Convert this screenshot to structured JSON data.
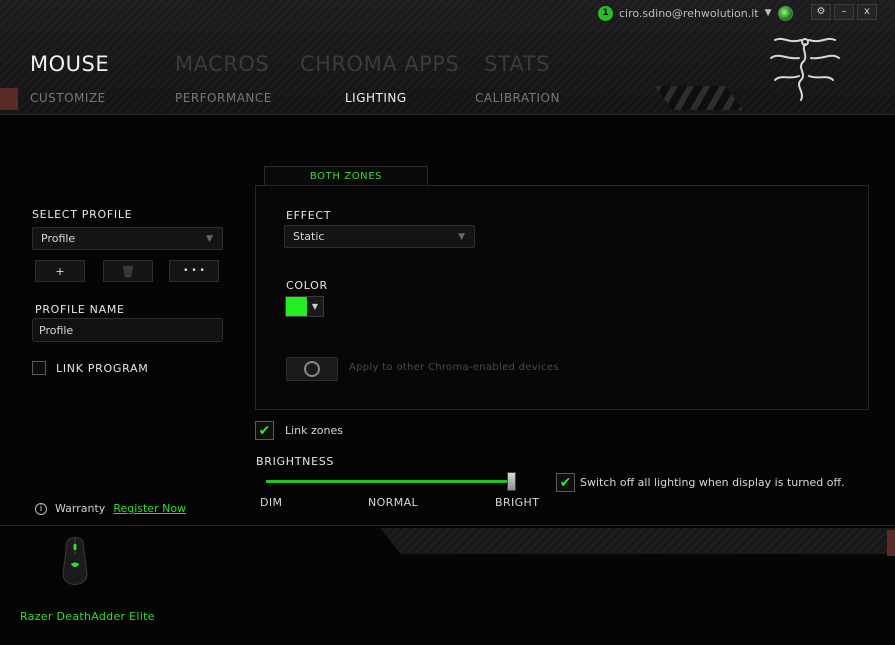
{
  "user": {
    "badge": "1",
    "email": "ciro.sdino@rehwolution.it"
  },
  "window_controls": {
    "settings": "⚙",
    "minimize": "–",
    "close": "x"
  },
  "main_nav": [
    "MOUSE",
    "MACROS",
    "CHROMA APPS",
    "STATS"
  ],
  "sub_nav": [
    "CUSTOMIZE",
    "PERFORMANCE",
    "LIGHTING",
    "CALIBRATION"
  ],
  "left": {
    "select_profile_label": "SELECT PROFILE",
    "profile_value": "Profile",
    "add_label": "+",
    "delete_label": "🗑",
    "more_label": "• • •",
    "profile_name_label": "PROFILE NAME",
    "profile_name_value": "Profile",
    "link_program_label": "LINK PROGRAM"
  },
  "lighting": {
    "tab_label": "BOTH ZONES",
    "effect_label": "EFFECT",
    "effect_value": "Static",
    "color_label": "COLOR",
    "color_value": "#22ee22",
    "apply_text": "Apply to other Chroma-enabled devices",
    "link_zones_label": "Link zones",
    "brightness_label": "BRIGHTNESS",
    "brightness_level": 1.0,
    "dim_label": "DIM",
    "normal_label": "NORMAL",
    "bright_label": "BRIGHT",
    "switch_off_label": "Switch off all lighting when display is turned off."
  },
  "footer": {
    "warranty_label": "Warranty",
    "register_label": "Register Now",
    "device_name": "Razer DeathAdder Elite"
  },
  "colors": {
    "accent": "#2ee02e",
    "active_nav": "#f0f0f0",
    "inactive_nav": "#3b3b3b"
  }
}
